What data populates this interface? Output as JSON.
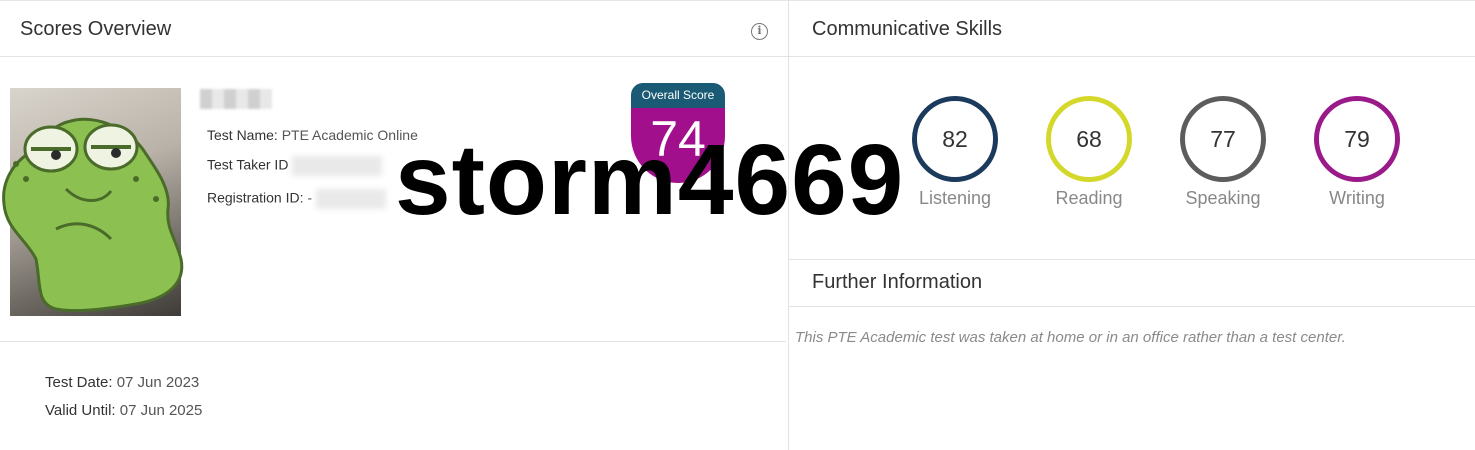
{
  "scores_overview": {
    "title": "Scores Overview",
    "info_icon": "info-icon",
    "test_name_label": "Test Name:",
    "test_name_value": "PTE Academic Online",
    "test_taker_id_label": "Test Taker ID",
    "registration_id_label": "Registration ID:",
    "registration_id_prefix": "-",
    "overall_score_label": "Overall Score",
    "overall_score_value": "74",
    "test_date_label": "Test Date:",
    "test_date_value": "07 Jun 2023",
    "valid_until_label": "Valid Until:",
    "valid_until_value": "07 Jun 2025"
  },
  "communicative_skills": {
    "title": "Communicative Skills",
    "skills": [
      {
        "label": "Listening",
        "score": "82",
        "color": "#1b3a5c"
      },
      {
        "label": "Reading",
        "score": "68",
        "color": "#d4d82a"
      },
      {
        "label": "Speaking",
        "score": "77",
        "color": "#5c5c5c"
      },
      {
        "label": "Writing",
        "score": "79",
        "color": "#9a1a8a"
      }
    ]
  },
  "further_information": {
    "title": "Further Information",
    "note": "This PTE Academic test was taken at home or in an office rather than a test center."
  },
  "colors": {
    "overall_top": "#1a5a74",
    "overall_bottom": "#a10f8c"
  },
  "watermark": "storm4669"
}
